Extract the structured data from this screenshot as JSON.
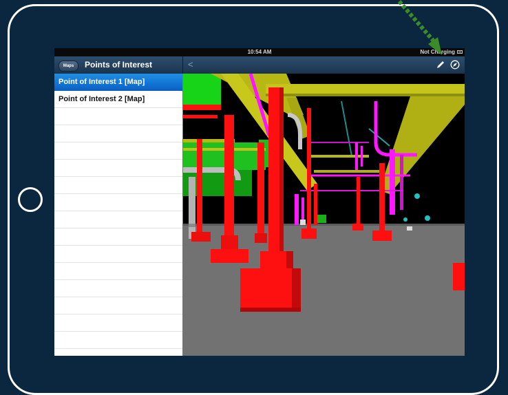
{
  "status_bar": {
    "time": "10:54 AM",
    "charging": "Not Charging"
  },
  "nav": {
    "maps_button": "Maps",
    "title": "Points of Interest",
    "back_label": "<"
  },
  "list": {
    "items": [
      {
        "label": "Point of Interest 1 [Map]",
        "selected": true
      },
      {
        "label": "Point of Interest 2 [Map]",
        "selected": false
      }
    ]
  },
  "icons": {
    "edit": "pencil-icon",
    "navigate": "compass-icon",
    "home": "home-button"
  },
  "colors": {
    "device_bg": "#0b2740",
    "selection": "#1479d6",
    "annotation_arrow": "#3c8b2a",
    "pipes_red": "#ff1010",
    "pipes_yellow": "#c2c21a",
    "pipes_magenta": "#ff18ff",
    "floor": "#727272"
  }
}
